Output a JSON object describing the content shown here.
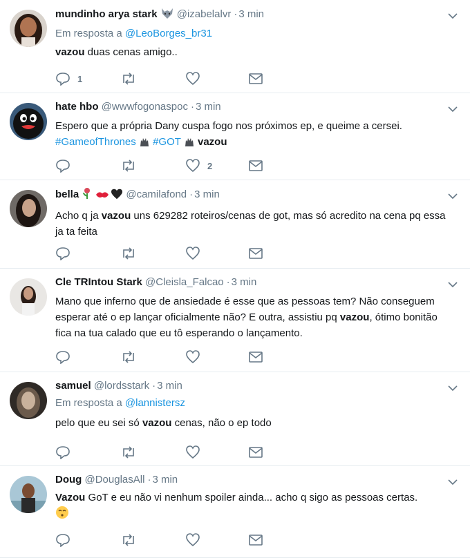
{
  "tweets": [
    {
      "name": "mundinho arya stark",
      "emoji": "wolf-emoji",
      "handle": "@izabelalvr",
      "time": "3 min",
      "reply_label": "Em resposta a ",
      "reply_mention": "@LeoBorges_br31",
      "text_bold": "vazou",
      "text_rest": " duas cenas amigo..",
      "reply_count": "1",
      "like_count": ""
    },
    {
      "name": "hate hbo",
      "handle": "@wwwfogonaspoc",
      "time": "3 min",
      "line1": "Espero que a própria  Dany cuspa fogo nos próximos ep, e queime a cersei.",
      "hashtag1": "#GameofThrones",
      "hashtag2": "#GOT",
      "text_bold": "vazou",
      "reply_count": "",
      "like_count": "2"
    },
    {
      "name": "bella",
      "emojis": [
        "rose-emoji",
        "kiss-mark-emoji",
        "black-heart-emoji"
      ],
      "handle": "@camilafond",
      "time": "3 min",
      "text_a": "Acho q ja ",
      "text_bold": "vazou",
      "text_b": " uns 629282 roteiros/cenas de got, mas só acredito na cena pq essa ja ta feita"
    },
    {
      "name": "Cle TRIntou Stark",
      "handle": "@Cleisla_Falcao",
      "time": "3 min",
      "text_a": "Mano que inferno que de ansiedade é esse que as pessoas tem? Não conseguem esperar até o ep lançar oficialmente não? E outra, assistiu pq ",
      "text_bold": "vazou",
      "text_b": ", ótimo bonitão fica na tua calado que eu tô esperando o lançamento."
    },
    {
      "name": "samuel",
      "handle": "@lordsstark",
      "time": "3 min",
      "reply_label": "Em resposta a ",
      "reply_mention": "@lannistersz",
      "text_a": "pelo que eu sei só ",
      "text_bold": "vazou",
      "text_b": " cenas, não o ep todo"
    },
    {
      "name": "Doug",
      "handle": "@DouglasAll",
      "time": "3 min",
      "text_bold": "Vazou",
      "text_b": " GoT e eu não vi nenhum spoiler ainda... acho q sigo as pessoas certas.",
      "trailing_emoji": "kissing-face-emoji"
    }
  ],
  "separator": "·",
  "colors": {
    "text": "#14171a",
    "muted": "#657786",
    "link": "#1b95e0",
    "border": "#e6ecf0"
  }
}
